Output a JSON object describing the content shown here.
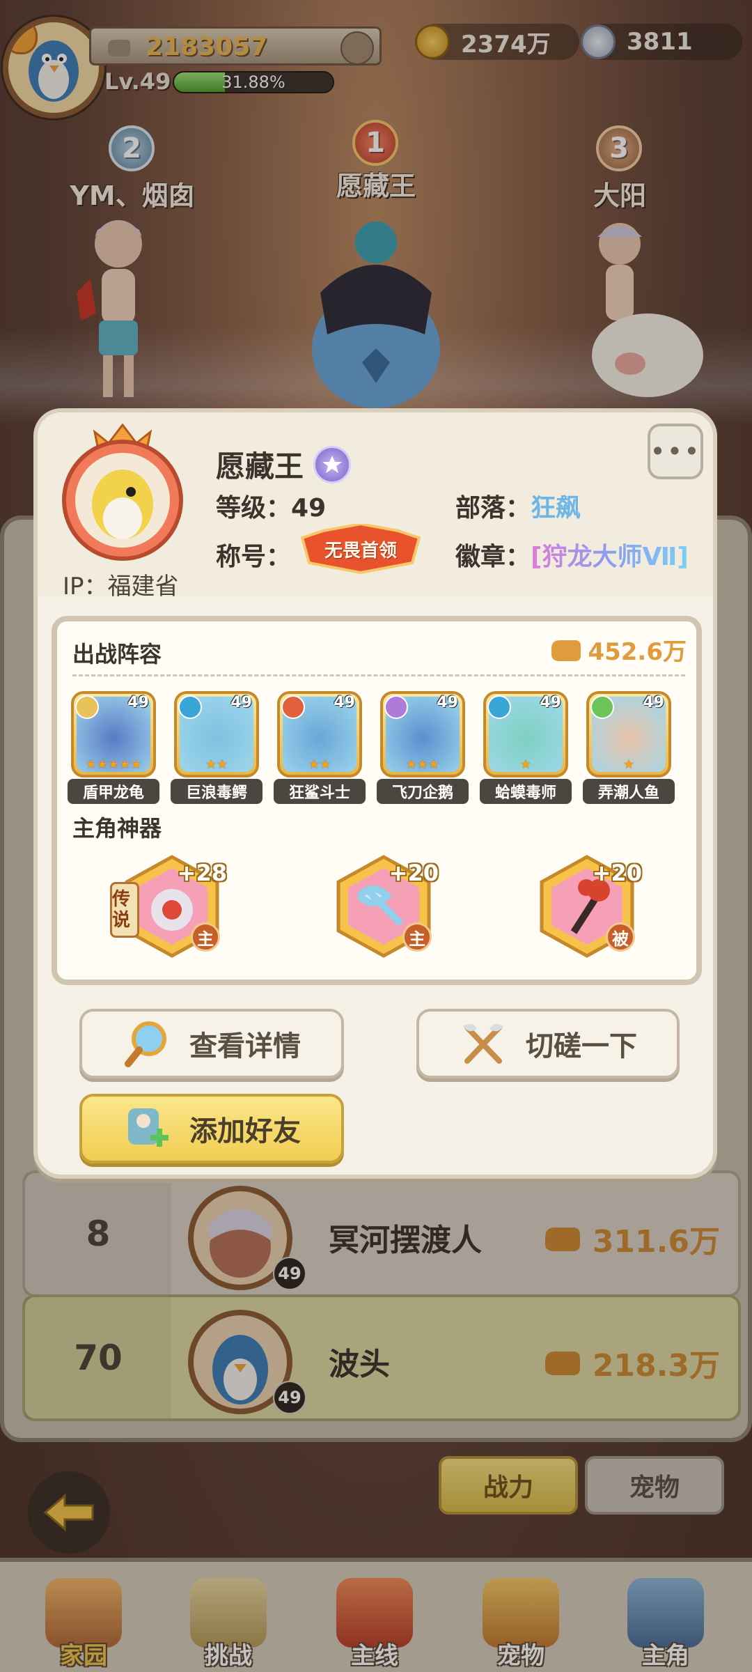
{
  "hud": {
    "power": "2183057",
    "level": "Lv.49",
    "exp_text": "31.88%",
    "exp_fraction": 0.3188,
    "gold": "2374万",
    "shells": "3811"
  },
  "podium": {
    "second": {
      "rank": "2",
      "name": "YM、烟囱"
    },
    "first": {
      "rank": "1",
      "name": "愿藏王"
    },
    "third": {
      "rank": "3",
      "name": "大阳"
    }
  },
  "ranking_rows": [
    {
      "rank": "8",
      "name": "冥河摆渡人",
      "level": "49",
      "power": "311.6万"
    },
    {
      "rank": "70",
      "name": "波头",
      "level": "49",
      "power": "218.3万"
    }
  ],
  "tabs": {
    "power": "战力",
    "pet": "宠物"
  },
  "bottom_nav": [
    {
      "label": "家园",
      "active": true
    },
    {
      "label": "挑战",
      "active": false
    },
    {
      "label": "主线",
      "active": false
    },
    {
      "label": "宠物",
      "active": false
    },
    {
      "label": "主角",
      "active": false
    }
  ],
  "profile": {
    "name": "愿藏王",
    "ip_label": "IP：",
    "ip_value": "福建省",
    "level_label": "等级：",
    "level_value": "49",
    "tribe_label": "部落：",
    "tribe_value": "狂飙",
    "title_label": "称号：",
    "title_value": "无畏首领",
    "badge_label": "徽章：",
    "badge_value": "[狩龙大师Ⅶ]",
    "more_icon": "•••"
  },
  "lineup": {
    "title": "出战阵容",
    "power": "452.6万",
    "pets": [
      {
        "name": "盾甲龙龟",
        "level": "49",
        "stars": "★★★★★",
        "type_color": "#e8c25a",
        "color": "#5b79c6"
      },
      {
        "name": "巨浪毒鳄",
        "level": "49",
        "stars": "★★",
        "type_color": "#3aa6d8",
        "color": "#7fc1df"
      },
      {
        "name": "狂鲨斗士",
        "level": "49",
        "stars": "★★",
        "type_color": "#e0613c",
        "color": "#6aa6d8"
      },
      {
        "name": "飞刀企鹅",
        "level": "49",
        "stars": "★★★",
        "type_color": "#b07ad8",
        "color": "#5a8fd0"
      },
      {
        "name": "蛤蟆毒师",
        "level": "49",
        "stars": "★",
        "type_color": "#3aa6d8",
        "color": "#7fd0c0"
      },
      {
        "name": "弄潮人鱼",
        "level": "49",
        "stars": "★",
        "type_color": "#6cc45a",
        "color": "#e8c2a8"
      }
    ],
    "artifact_title": "主角神器",
    "artifacts": [
      {
        "level": "+28",
        "tag": "主",
        "legend": "传说"
      },
      {
        "level": "+20",
        "tag": "主"
      },
      {
        "level": "+20",
        "tag": "被"
      }
    ]
  },
  "actions": {
    "detail": "查看详情",
    "duel": "切磋一下",
    "add_friend": "添加好友"
  },
  "colors": {
    "accent_gold": "#e09b3c",
    "tribe_blue": "#6fb5e6",
    "friend_yellow": "#f1cd52"
  }
}
